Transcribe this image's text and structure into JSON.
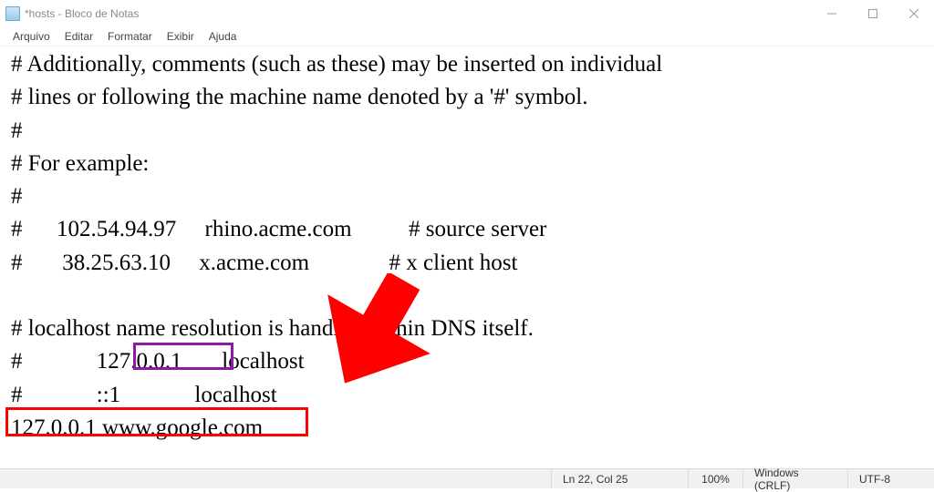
{
  "title": "*hosts - Bloco de Notas",
  "menu": {
    "file": "Arquivo",
    "edit": "Editar",
    "format": "Formatar",
    "view": "Exibir",
    "help": "Ajuda"
  },
  "content": {
    "l1": "# Additionally, comments (such as these) may be inserted on individual",
    "l2": "# lines or following the machine name denoted by a '#' symbol.",
    "l3": "#",
    "l4": "# For example:",
    "l5": "#",
    "l6": "#      102.54.94.97     rhino.acme.com          # source server",
    "l7": "#       38.25.63.10     x.acme.com              # x client host",
    "l8": "",
    "l9": "# localhost name resolution is handled within DNS itself.",
    "l10": "#             127.0.0.1       localhost",
    "l11": "#             ::1             localhost",
    "l12": "127.0.0.1 www.google.com"
  },
  "status": {
    "pos": "Ln 22, Col 25",
    "zoom": "100%",
    "lineend": "Windows (CRLF)",
    "encoding": "UTF-8"
  }
}
